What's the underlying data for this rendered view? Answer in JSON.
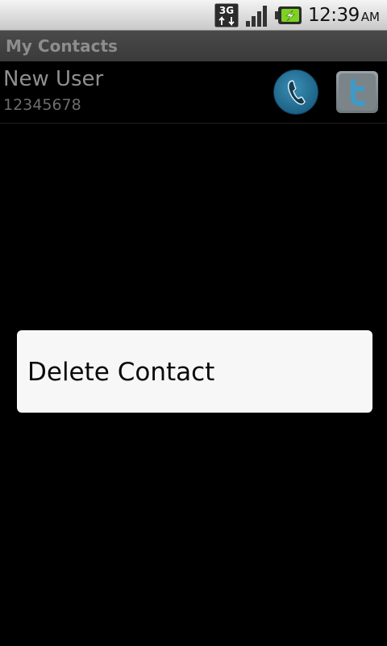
{
  "status_bar": {
    "network": "3G",
    "time": "12:39",
    "ampm": "AM",
    "icons": [
      "3g-data-icon",
      "signal-strength-icon",
      "battery-charging-icon"
    ]
  },
  "title_bar": {
    "title": "My Contacts"
  },
  "contacts": [
    {
      "name": "New User",
      "number": "12345678",
      "actions": [
        "phone-icon",
        "twitter-icon"
      ]
    }
  ],
  "context_menu": {
    "items": [
      {
        "label": "Delete Contact"
      }
    ]
  },
  "colors": {
    "background": "#000000",
    "title_bar": "#424242",
    "title_text": "#8d8d8d",
    "menu_bg": "#f7f7f7",
    "call_button": "#1d6388",
    "twitter_button": "#7d868b"
  }
}
